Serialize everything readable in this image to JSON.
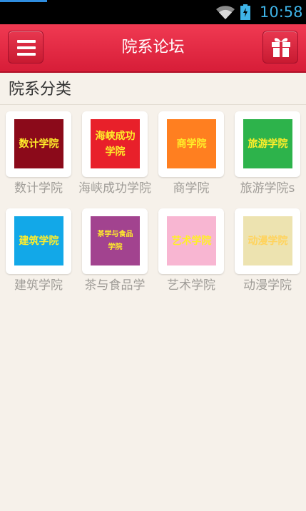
{
  "status": {
    "time": "10:58",
    "wifi_icon": "wifi-icon",
    "battery_icon": "battery-charging-icon"
  },
  "header": {
    "title": "院系论坛",
    "menu_icon": "hamburger-menu-icon",
    "gift_icon": "gift-icon",
    "color": "#e52b45"
  },
  "section": {
    "title": "院系分类"
  },
  "colleges": [
    {
      "label": "数计学院",
      "icon_text_1": "数计学院",
      "icon_text_2": "",
      "color": "#8b0a1a"
    },
    {
      "label": "海峡成功学院",
      "icon_text_1": "海峡成功",
      "icon_text_2": "学院",
      "color": "#e8202a"
    },
    {
      "label": "商学院",
      "icon_text_1": "商学院",
      "icon_text_2": "",
      "color": "#ff7f20"
    },
    {
      "label": "旅游学院s",
      "icon_text_1": "旅游学院",
      "icon_text_2": "",
      "color": "#2db34b"
    },
    {
      "label": "建筑学院",
      "icon_text_1": "建筑学院",
      "icon_text_2": "",
      "color": "#12a8e8"
    },
    {
      "label": "茶与食品学",
      "icon_text_1": "茶学与食品",
      "icon_text_2": "学院",
      "color": "#a2438f"
    },
    {
      "label": "艺术学院",
      "icon_text_1": "艺术学院",
      "icon_text_2": "",
      "color": "#f8b6d2"
    },
    {
      "label": "动漫学院",
      "icon_text_1": "动漫学院",
      "icon_text_2": "",
      "color": "#ede3b0"
    }
  ]
}
